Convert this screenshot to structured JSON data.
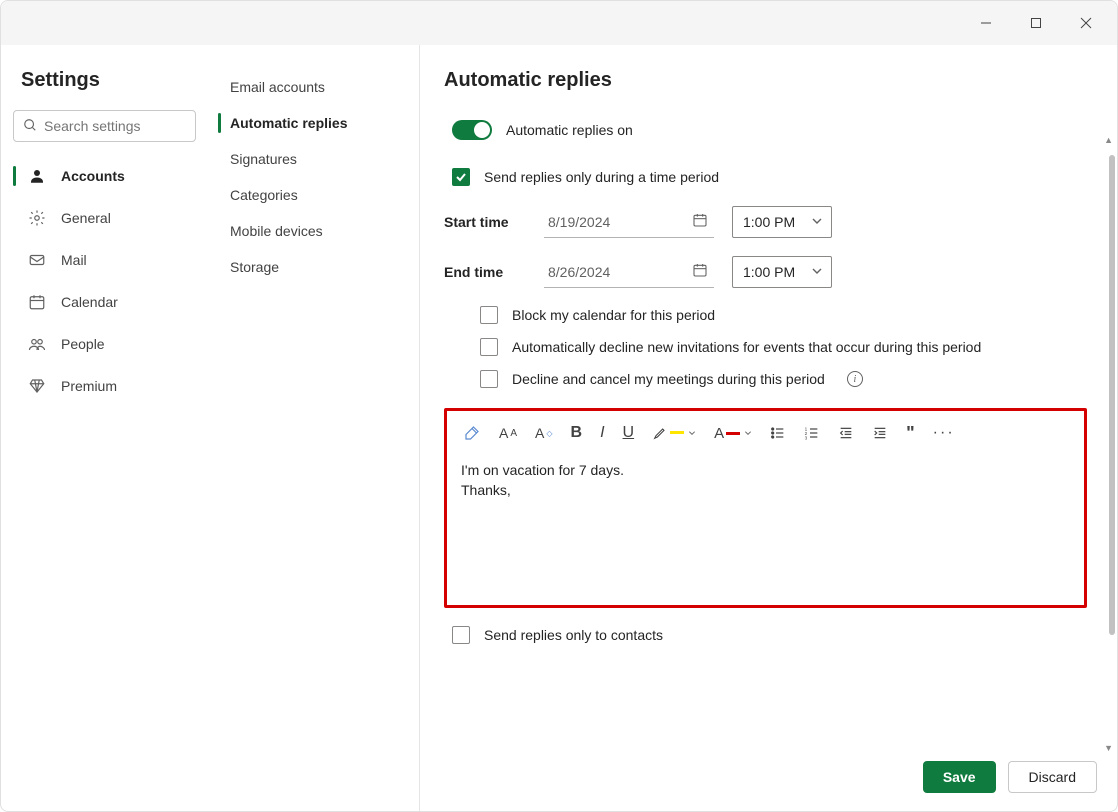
{
  "settings_title": "Settings",
  "search": {
    "placeholder": "Search settings"
  },
  "nav1": {
    "items": [
      {
        "label": "Accounts"
      },
      {
        "label": "General"
      },
      {
        "label": "Mail"
      },
      {
        "label": "Calendar"
      },
      {
        "label": "People"
      },
      {
        "label": "Premium"
      }
    ]
  },
  "nav2": {
    "items": [
      {
        "label": "Email accounts"
      },
      {
        "label": "Automatic replies"
      },
      {
        "label": "Signatures"
      },
      {
        "label": "Categories"
      },
      {
        "label": "Mobile devices"
      },
      {
        "label": "Storage"
      }
    ]
  },
  "page_title": "Automatic replies",
  "toggle_label": "Automatic replies on",
  "time_period_label": "Send replies only during a time period",
  "start_label": "Start time",
  "end_label": "End time",
  "start_date": "8/19/2024",
  "end_date": "8/26/2024",
  "start_time": "1:00 PM",
  "end_time": "1:00 PM",
  "sub_checks": {
    "block_calendar": "Block my calendar for this period",
    "decline_new": "Automatically decline new invitations for events that occur during this period",
    "decline_cancel": "Decline and cancel my meetings during this period"
  },
  "editor": {
    "line1": "I'm on vacation for 7 days.",
    "line2": "Thanks,"
  },
  "contacts_only_label": "Send replies only to contacts",
  "buttons": {
    "save": "Save",
    "discard": "Discard"
  }
}
